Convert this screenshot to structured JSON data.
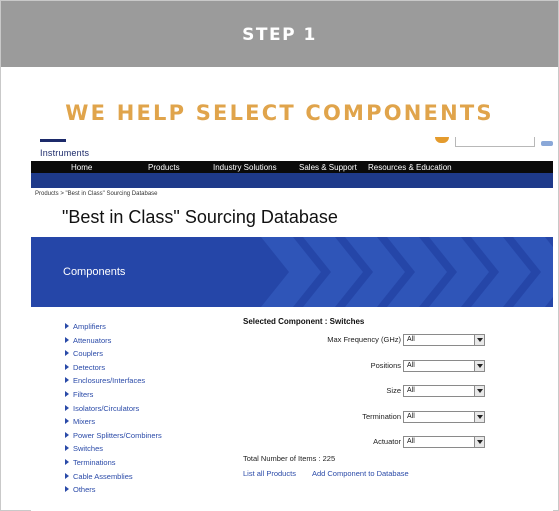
{
  "step_label": "STEP 1",
  "headline": "WE HELP SELECT COMPONENTS",
  "site": {
    "logo_text": "Instruments",
    "search_placeholder": "",
    "nav": [
      "Home",
      "Products",
      "Industry Solutions",
      "Sales & Support",
      "Resources & Education"
    ],
    "breadcrumb": "Products > \"Best in Class\" Sourcing Database",
    "page_title": "\"Best in Class\" Sourcing Database",
    "banner_title": "Components",
    "colors": {
      "nav_bg": "#0a0a0a",
      "nav_accent": "#1e3a8a",
      "banner": "#2546a8",
      "link": "#2a4aa8",
      "headline": "#e0a44b",
      "step_bar": "#9b9b9b"
    }
  },
  "sidebar": {
    "items": [
      "Amplifiers",
      "Attenuators",
      "Couplers",
      "Detectors",
      "Enclosures/Interfaces",
      "Filters",
      "Isolators/Circulators",
      "Mixers",
      "Power Splitters/Combiners",
      "Switches",
      "Terminations",
      "Cable Assemblies",
      "Others"
    ]
  },
  "panel": {
    "title": "Selected Component : Switches",
    "fields": [
      {
        "label": "Max Frequency (GHz)",
        "value": "All"
      },
      {
        "label": "Positions",
        "value": "All"
      },
      {
        "label": "Size",
        "value": "All"
      },
      {
        "label": "Termination",
        "value": "All"
      },
      {
        "label": "Actuator",
        "value": "All"
      }
    ],
    "total": "Total Number of Items : 225",
    "link_list_all": "List all Products",
    "link_add": "Add Component to Database"
  }
}
